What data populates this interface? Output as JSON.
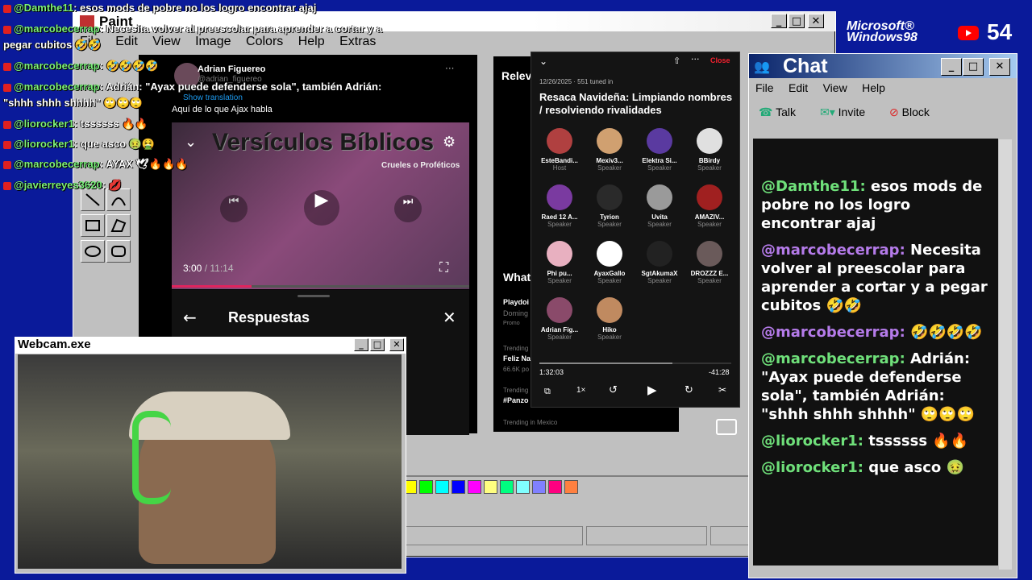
{
  "stream": {
    "windows_logo": "Microsoft® Windows98",
    "viewer_count": "54"
  },
  "overlay_chat": [
    {
      "user": "@Damthe11",
      "text": ": esos mods de pobre no los logro encontrar ajaj"
    },
    {
      "user": "@marcobecerrap",
      "text": ": Necesita volver al preescolar para aprender a cortar y a"
    },
    {
      "user": "",
      "text": "pegar cubitos 🤣🤣"
    },
    {
      "user": "@marcobecerrap",
      "text": ": 🤣🤣🤣🤣"
    },
    {
      "user": "@marcobecerrap",
      "text": ": Adrián: \"Ayax puede defenderse sola\", también Adrián:"
    },
    {
      "user": "",
      "text": "\"shhh shhh shhhh\" 🙄🙄🙄"
    },
    {
      "user": "@liorocker1",
      "text": ": tssssss 🔥🔥"
    },
    {
      "user": "@liorocker1",
      "text": ": que asco 🤢🤮"
    },
    {
      "user": "@marcobecerrap",
      "text": ": AYAX 🕊🔥🔥🔥"
    },
    {
      "user": "@javierreyes3620",
      "text": ": 💋"
    }
  ],
  "paint": {
    "title": "Paint",
    "menu": [
      "File",
      "Edit",
      "View",
      "Image",
      "Colors",
      "Help",
      "Extras"
    ]
  },
  "tweet": {
    "author": "Adrian Figuereo",
    "handle": "@adrian_figuereo",
    "show_translation": "Show translation",
    "text": "Aquí de lo que Ajax habla",
    "video_overlay": "Versículos Bíblicos",
    "video_sub": "Crueles o Proféticos",
    "time_current": "3:00",
    "time_total": "/ 11:14",
    "replies_title": "Respuestas"
  },
  "right_column": {
    "relevant": "Relev",
    "whats": "What",
    "playdoi": "Playdoi",
    "domingo": "Doming",
    "promo": "Promo",
    "trending1": "Trending",
    "feliz": "Feliz Na",
    "posts": "66.6K po",
    "trending2": "Trending",
    "panzo": "#Panzo",
    "trending_mx": "Trending in Mexico"
  },
  "space": {
    "close": "Close",
    "meta": "12/26/2025 · 551 tuned in",
    "title": "Resaca Navideña: Limpiando nombres / resolviendo rivalidades",
    "participants": [
      {
        "name": "EsteBandi...",
        "role": "Host",
        "color": "#b04040"
      },
      {
        "name": "Mexiv3...",
        "role": "Speaker",
        "color": "#d0a070"
      },
      {
        "name": "Elektra Si...",
        "role": "Speaker",
        "color": "#5a3aa0"
      },
      {
        "name": "BBirdy",
        "role": "Speaker",
        "color": "#e0e0e0"
      },
      {
        "name": "Raed 12 A...",
        "role": "Speaker",
        "color": "#7a3aa0"
      },
      {
        "name": "Tyrion",
        "role": "Speaker",
        "color": "#2a2a2a"
      },
      {
        "name": "Uvita",
        "role": "Speaker",
        "color": "#9a9a9a"
      },
      {
        "name": "AMAZIV...",
        "role": "Speaker",
        "color": "#a02020"
      },
      {
        "name": "Phi pu...",
        "role": "Speaker",
        "color": "#e8b0c0"
      },
      {
        "name": "AyaxGallo",
        "role": "Speaker",
        "color": "#ffffff"
      },
      {
        "name": "SgtAkumaX",
        "role": "Speaker",
        "color": "#222222"
      },
      {
        "name": "DROZZZ E...",
        "role": "Speaker",
        "color": "#6a5a5a"
      },
      {
        "name": "Adrian Fig...",
        "role": "Speaker",
        "color": "#8a4a6a"
      },
      {
        "name": "Hiko",
        "role": "Speaker",
        "color": "#c08a60"
      }
    ],
    "elapsed": "1:32:03",
    "remaining": "-41:28",
    "speed": "1×"
  },
  "chat": {
    "title": "Chat",
    "menu": [
      "File",
      "Edit",
      "View",
      "Help"
    ],
    "toolbar": {
      "talk": "Talk",
      "invite": "Invite",
      "block": "Block"
    },
    "messages": [
      {
        "user": "@Damthe11:",
        "text": " esos mods de pobre no los logro encontrar ajaj",
        "uc": "u"
      },
      {
        "user": "@marcobecerrap:",
        "text": " Necesita volver al preescolar para aprender a cortar y a pegar cubitos 🤣🤣",
        "uc": "p"
      },
      {
        "user": "@marcobecerrap:",
        "text": " 🤣🤣🤣🤣",
        "uc": "p"
      },
      {
        "user": "@marcobecerrap:",
        "text": " Adrián: \"Ayax puede defenderse sola\", también Adrián: \"shhh shhh shhhh\" 🙄🙄🙄",
        "uc": "u"
      },
      {
        "user": "@liorocker1:",
        "text": " tssssss 🔥🔥",
        "uc": "u"
      },
      {
        "user": "@liorocker1:",
        "text": " que asco 🤢",
        "uc": "u"
      }
    ]
  },
  "webcam": {
    "title": "Webcam.exe"
  },
  "palette": [
    "#ffff00",
    "#00ff00",
    "#00ffff",
    "#0000ff",
    "#ff00ff",
    "#ffff80",
    "#00ff80",
    "#80ffff",
    "#8080ff",
    "#ff0080",
    "#ff8040"
  ],
  "colors": {
    "desktop": "#0a1a9a",
    "chat_green": "#6fe07a",
    "chat_purple": "#b57bea"
  }
}
